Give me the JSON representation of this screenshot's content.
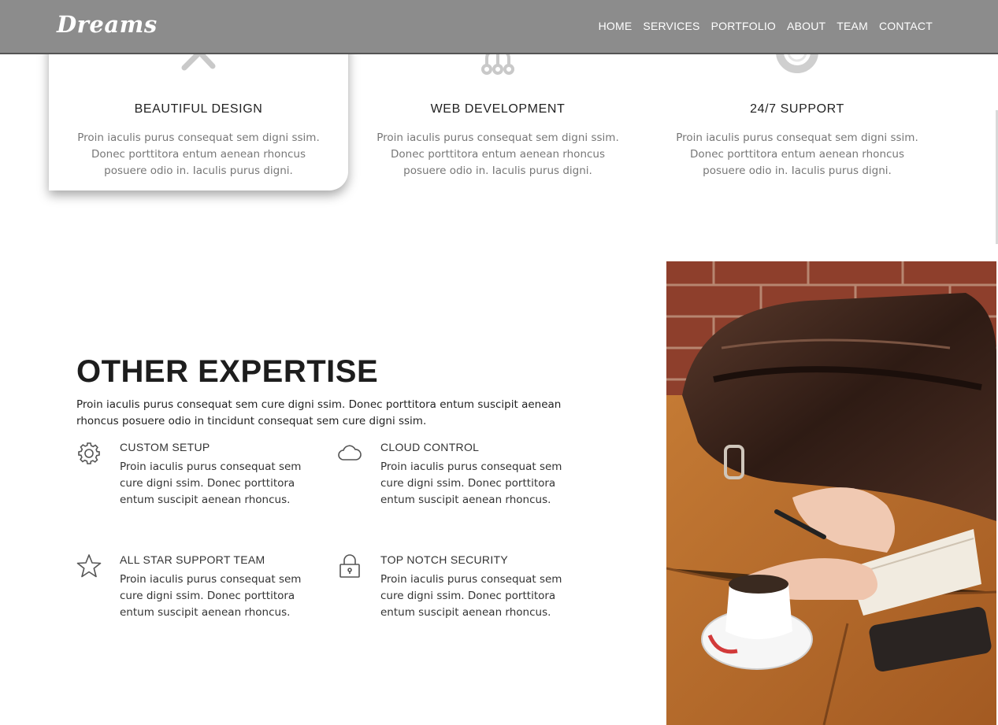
{
  "brand": {
    "logo": "Dreams"
  },
  "nav": {
    "items": [
      "HOME",
      "SERVICES",
      "PORTFOLIO",
      "ABOUT",
      "TEAM",
      "CONTACT"
    ]
  },
  "services": [
    {
      "title": "BEAUTIFUL DESIGN",
      "icon": "tools-icon",
      "text": "Proin iaculis purus consequat sem digni ssim. Donec porttitora entum aenean rhoncus posuere odio in. Iaculis purus digni."
    },
    {
      "title": "WEB DEVELOPMENT",
      "icon": "network-icon",
      "text": "Proin iaculis purus consequat sem digni ssim. Donec porttitora entum aenean rhoncus posuere odio in. Iaculis purus digni."
    },
    {
      "title": "24/7 SUPPORT",
      "icon": "lifebuoy-icon",
      "text": "Proin iaculis purus consequat sem digni ssim. Donec porttitora entum aenean rhoncus posuere odio in. Iaculis purus digni."
    }
  ],
  "expertise": {
    "title": "OTHER EXPERTISE",
    "intro": "Proin iaculis purus consequat sem cure digni ssim. Donec porttitora entum suscipit aenean rhoncus posuere odio in tincidunt consequat sem cure digni ssim.",
    "features": [
      {
        "title": "CUSTOM SETUP",
        "icon": "gear-icon",
        "text": "Proin iaculis purus consequat sem cure digni ssim. Donec porttitora entum suscipit aenean rhoncus."
      },
      {
        "title": "CLOUD CONTROL",
        "icon": "cloud-icon",
        "text": "Proin iaculis purus consequat sem cure digni ssim. Donec porttitora entum suscipit aenean rhoncus."
      },
      {
        "title": "ALL STAR SUPPORT TEAM",
        "icon": "star-icon",
        "text": "Proin iaculis purus consequat sem cure digni ssim. Donec porttitora entum suscipit aenean rhoncus."
      },
      {
        "title": "TOP NOTCH SECURITY",
        "icon": "lock-icon",
        "text": "Proin iaculis purus consequat sem cure digni ssim. Donec porttitora entum suscipit aenean rhoncus."
      }
    ]
  },
  "colors": {
    "header_bg": "#8c8c8c",
    "text_dark": "#1d1d1d",
    "text_muted": "#777777"
  }
}
